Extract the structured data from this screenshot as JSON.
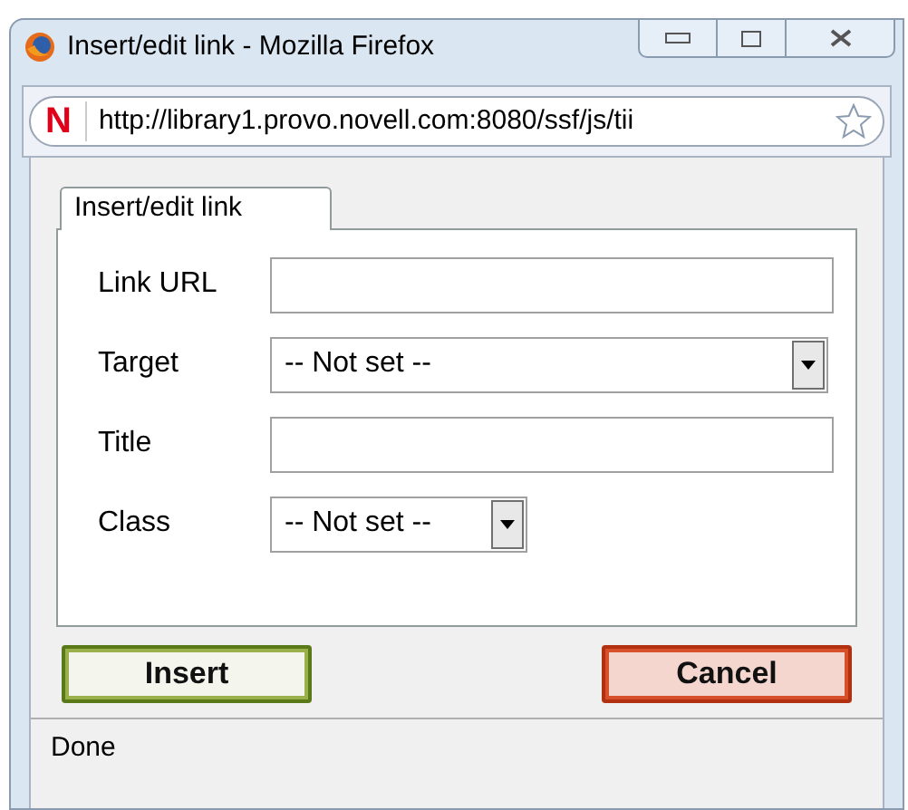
{
  "window": {
    "title": "Insert/edit link - Mozilla Firefox"
  },
  "address_bar": {
    "site_icon": "N",
    "url": "http://library1.provo.novell.com:8080/ssf/js/tii"
  },
  "tabs": [
    {
      "label": "Insert/edit link",
      "selected": true
    }
  ],
  "fields": [
    {
      "kind": "text",
      "label": "Link URL"
    },
    {
      "kind": "select",
      "label": "Target",
      "value": "-- Not set --",
      "wide": true
    },
    {
      "kind": "text",
      "label": "Title"
    },
    {
      "kind": "select",
      "label": "Class",
      "value": "-- Not set --",
      "wide": false
    }
  ],
  "buttons": [
    {
      "kind": "insert",
      "label": "Insert"
    },
    {
      "kind": "cancel",
      "label": "Cancel"
    }
  ],
  "status_bar": "Done"
}
